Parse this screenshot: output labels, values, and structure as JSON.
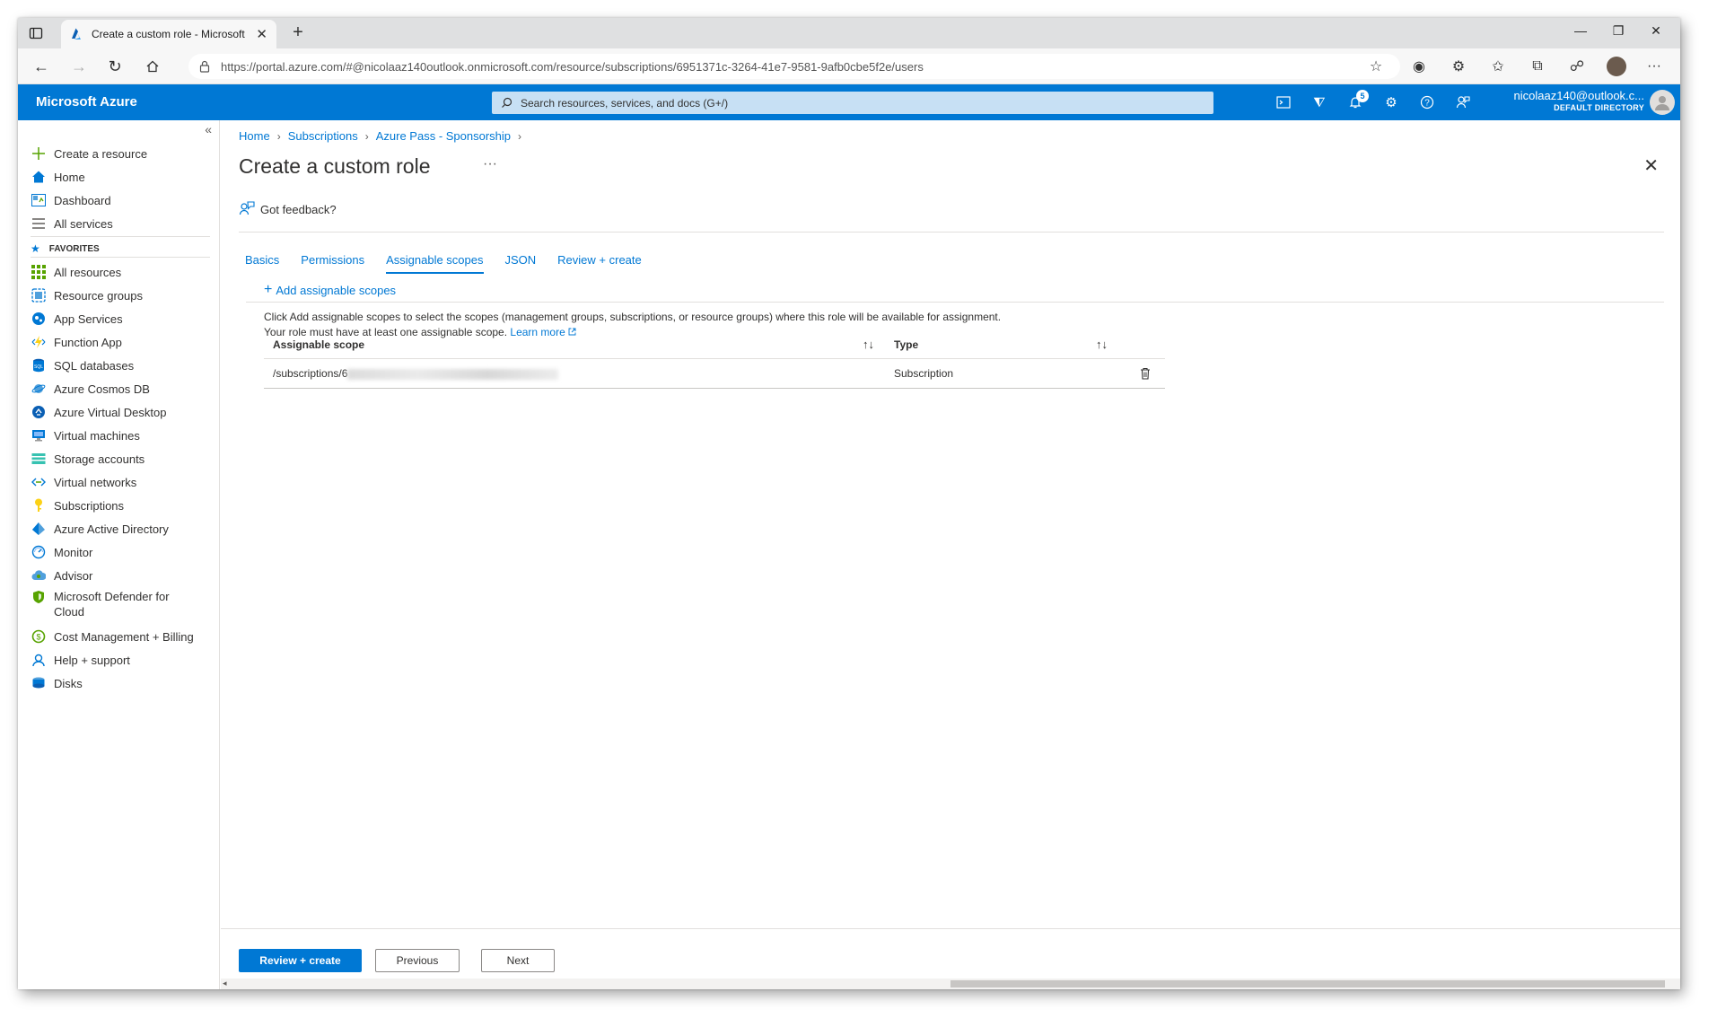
{
  "browser": {
    "tab_title": "Create a custom role - Microsoft",
    "url": "https://portal.azure.com/#@nicolaaz140outlook.onmicrosoft.com/resource/subscriptions/6951371c-3264-41e7-9581-9afb0cbe5f2e/users"
  },
  "header": {
    "brand": "Microsoft Azure",
    "search_placeholder": "Search resources, services, and docs (G+/)",
    "notification_count": "5",
    "account_email": "nicolaaz140@outlook.c...",
    "account_directory": "DEFAULT DIRECTORY"
  },
  "sidebar": {
    "collapse_glyph": "«",
    "top_items": [
      {
        "label": "Create a resource",
        "icon": "plus-icon"
      },
      {
        "label": "Home",
        "icon": "home-icon"
      },
      {
        "label": "Dashboard",
        "icon": "dashboard-icon"
      },
      {
        "label": "All services",
        "icon": "list-icon"
      }
    ],
    "favorites_label": "FAVORITES",
    "favorites": [
      {
        "label": "All resources",
        "icon": "grid-icon"
      },
      {
        "label": "Resource groups",
        "icon": "resource-groups-icon"
      },
      {
        "label": "App Services",
        "icon": "app-services-icon"
      },
      {
        "label": "Function App",
        "icon": "function-app-icon"
      },
      {
        "label": "SQL databases",
        "icon": "sql-icon"
      },
      {
        "label": "Azure Cosmos DB",
        "icon": "cosmos-icon"
      },
      {
        "label": "Azure Virtual Desktop",
        "icon": "virtual-desktop-icon"
      },
      {
        "label": "Virtual machines",
        "icon": "vm-icon"
      },
      {
        "label": "Storage accounts",
        "icon": "storage-icon"
      },
      {
        "label": "Virtual networks",
        "icon": "vnet-icon"
      },
      {
        "label": "Subscriptions",
        "icon": "key-icon"
      },
      {
        "label": "Azure Active Directory",
        "icon": "aad-icon"
      },
      {
        "label": "Monitor",
        "icon": "monitor-icon"
      },
      {
        "label": "Advisor",
        "icon": "advisor-icon"
      },
      {
        "label": "Microsoft Defender for Cloud",
        "icon": "shield-icon"
      },
      {
        "label": "Cost Management + Billing",
        "icon": "cost-icon"
      },
      {
        "label": "Help + support",
        "icon": "help-icon"
      },
      {
        "label": "Disks",
        "icon": "disk-icon"
      }
    ]
  },
  "main": {
    "breadcrumb": [
      "Home",
      "Subscriptions",
      "Azure Pass - Sponsorship"
    ],
    "title": "Create a custom role",
    "more_glyph": "···",
    "feedback": "Got feedback?",
    "tabs": [
      "Basics",
      "Permissions",
      "Assignable scopes",
      "JSON",
      "Review + create"
    ],
    "active_tab": "Assignable scopes",
    "add_scopes": "Add assignable scopes",
    "desc_line1": "Click Add assignable scopes to select the scopes (management groups, subscriptions, or resource groups) where this role will be available for assignment.",
    "desc_line2": "Your role must have at least one assignable scope.",
    "learn_more": "Learn more",
    "grid": {
      "columns": [
        "Assignable scope",
        "Type"
      ],
      "rows": [
        {
          "scope": "/subscriptions/6",
          "type": "Subscription"
        }
      ]
    },
    "buttons": {
      "review_create": "Review + create",
      "previous": "Previous",
      "next": "Next"
    }
  },
  "colors": {
    "azure_blue": "#0078d4",
    "search_bg": "#c7e0f4"
  }
}
